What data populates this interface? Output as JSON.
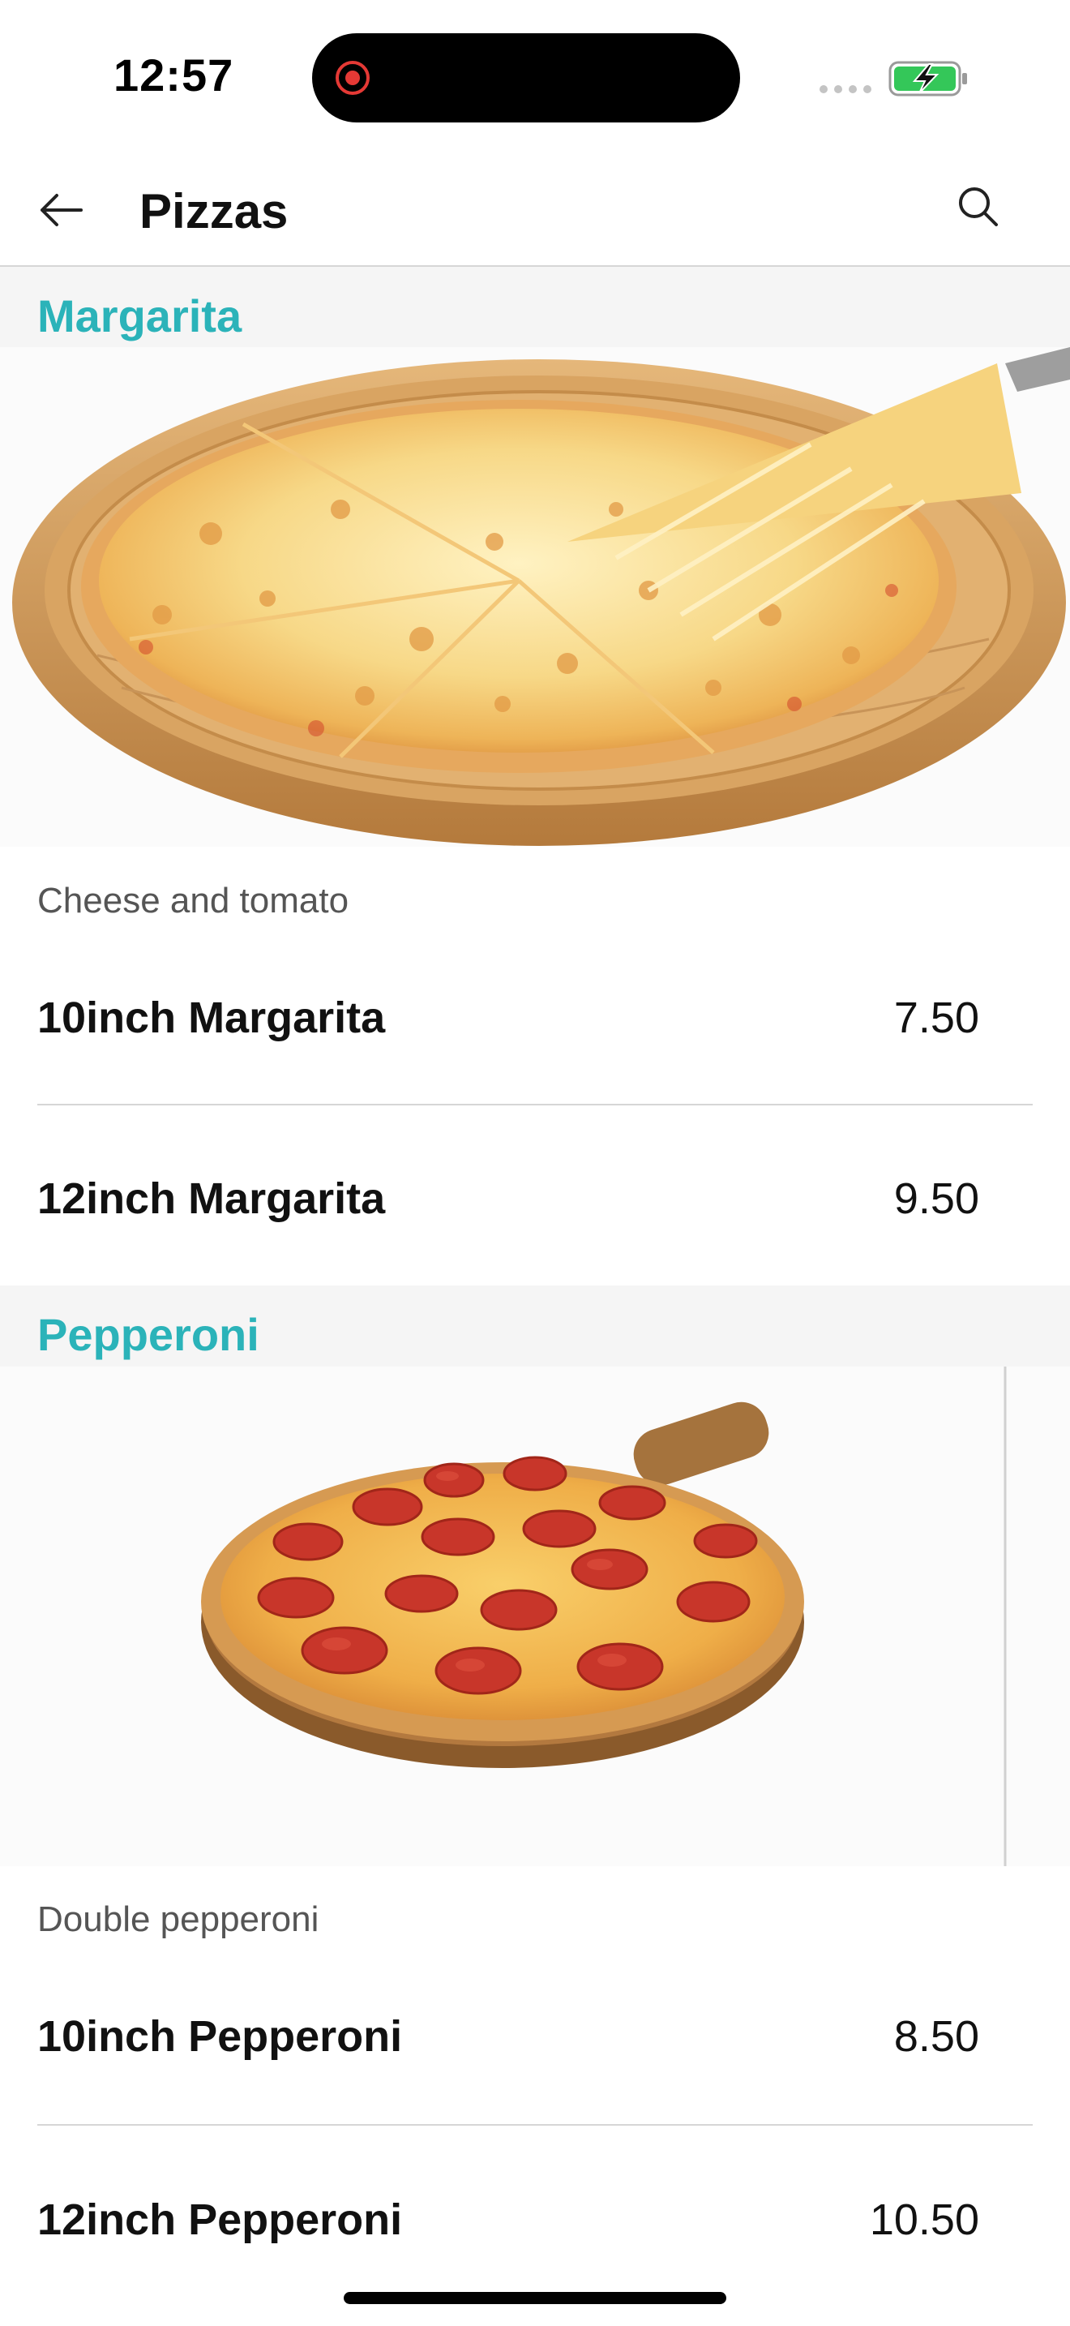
{
  "status_bar": {
    "time": "12:57",
    "battery_color": "#34c759"
  },
  "nav": {
    "title": "Pizzas",
    "back_icon": "arrow-left-icon",
    "search_icon": "search-icon"
  },
  "theme": {
    "accent": "#2bb3b9"
  },
  "sections": [
    {
      "title": "Margarita",
      "description": "Cheese and tomato",
      "items": [
        {
          "name": "10inch Margarita",
          "price": "7.50"
        },
        {
          "name": "12inch Margarita",
          "price": "9.50"
        }
      ]
    },
    {
      "title": "Pepperoni",
      "description": "Double pepperoni",
      "items": [
        {
          "name": "10inch Pepperoni",
          "price": "8.50"
        },
        {
          "name": "12inch Pepperoni",
          "price": "10.50"
        }
      ]
    }
  ]
}
